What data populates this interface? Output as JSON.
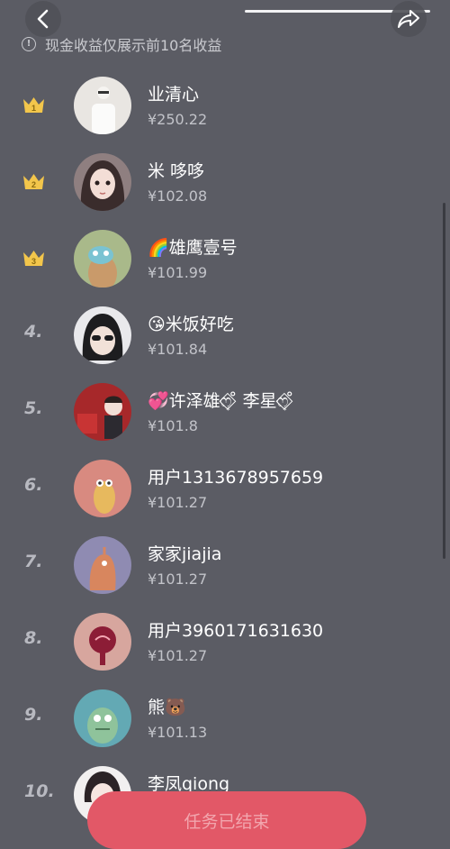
{
  "notice": {
    "text": "现金收益仅展示前10名收益"
  },
  "ranking": [
    {
      "rank": "1",
      "badge": "crown-gold",
      "name": "业清心",
      "amount": "¥250.22"
    },
    {
      "rank": "2",
      "badge": "crown-gold",
      "name": "米 哆哆",
      "amount": "¥102.08"
    },
    {
      "rank": "3",
      "badge": "crown-gold",
      "name": "🌈雄鹰壹号",
      "amount": "¥101.99"
    },
    {
      "rank": "4.",
      "name": "😘米饭好吃",
      "amount": "¥101.84"
    },
    {
      "rank": "5.",
      "name": "💞许泽雄ෆ͙⃟ ̊ 李星ෆ͙⃟ ̊",
      "amount": "¥101.8"
    },
    {
      "rank": "6.",
      "name": "用户1313678957659",
      "amount": "¥101.27"
    },
    {
      "rank": "7.",
      "name": "家家jiajia",
      "amount": "¥101.27"
    },
    {
      "rank": "8.",
      "name": "用户3960171631630",
      "amount": "¥101.27"
    },
    {
      "rank": "9.",
      "name": "熊🐻",
      "amount": "¥101.13"
    },
    {
      "rank": "10.",
      "name": "李凤qiong",
      "amount": ""
    }
  ],
  "footer": {
    "button_label": "任务已结束"
  },
  "colors": {
    "background": "#5b5c64",
    "crown": "#f3c64b",
    "button": "#e25867",
    "button_text": "#f2a6ae"
  }
}
